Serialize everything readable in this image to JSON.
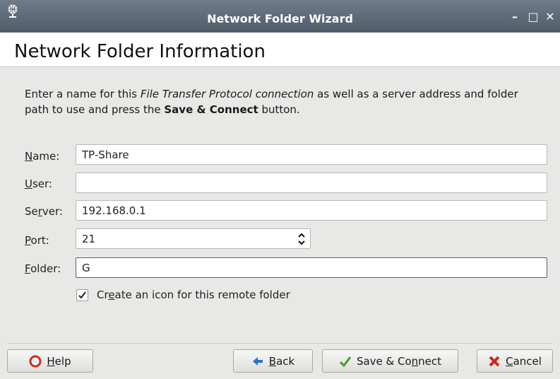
{
  "window": {
    "title": "Network Folder Wizard",
    "minimize_glyph": "–",
    "maximize_glyph": "□",
    "close_glyph": "✕"
  },
  "header": {
    "heading": "Network Folder Information"
  },
  "intro": {
    "part1": "Enter a name for this ",
    "protocol": "File Transfer Protocol connection",
    "part2": " as well as a server address and folder path to use and press the ",
    "button_ref": "Save & Connect",
    "part3": " button."
  },
  "form": {
    "name": {
      "label_u": "N",
      "label_rest": "ame:",
      "value": "TP-Share"
    },
    "user": {
      "label_u": "U",
      "label_rest": "ser:",
      "value": ""
    },
    "server": {
      "label_pre": "Se",
      "label_u": "r",
      "label_rest": "ver:",
      "value": "192.168.0.1"
    },
    "port": {
      "label_u": "P",
      "label_rest": "ort:",
      "value": "21"
    },
    "folder": {
      "label_u": "F",
      "label_rest": "older:",
      "value": "G"
    },
    "create_icon": {
      "checked": true,
      "label_pre": "Cr",
      "label_u": "e",
      "label_rest": "ate an icon for this remote folder"
    }
  },
  "buttons": {
    "help": {
      "label_u": "H",
      "label_rest": "elp",
      "icon": "lifebuoy-icon"
    },
    "back": {
      "label_u": "B",
      "label_rest": "ack",
      "icon": "left-arrow-icon"
    },
    "save_connect": {
      "label": "Save & Co",
      "label_u": "n",
      "label_rest": "nect",
      "icon": "checkmark-icon"
    },
    "cancel": {
      "label_u": "C",
      "label_rest": "ancel",
      "icon": "red-x-icon"
    }
  },
  "colors": {
    "titlebar": "#5a6572",
    "accent_red": "#cc2a1f",
    "accent_green": "#4a9a2a",
    "accent_blue": "#2f6fd0"
  }
}
